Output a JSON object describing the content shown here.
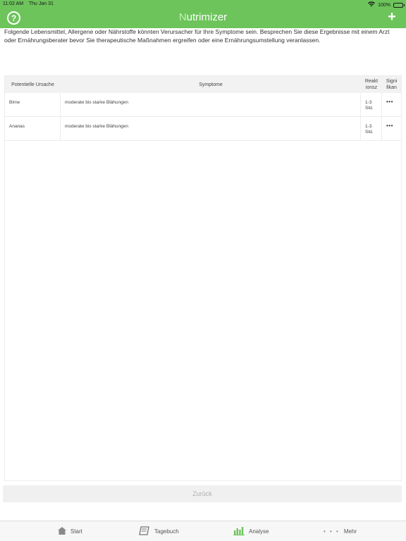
{
  "status": {
    "time": "11:02 AM",
    "date": "Thu Jan 31",
    "battery": "100%"
  },
  "header": {
    "title_first": "N",
    "title_rest": "utrimizer",
    "help_icon": "?",
    "add_icon": "+"
  },
  "intro": "Folgende Lebensmittel, Allergene oder Nährstoffe könnten Verursacher für Ihre Symptome sein. Besprechen Sie diese Ergebnisse mit einem Arzt oder Ernährungsberater bevor Sie therapeutische Maßnahmen ergreifen oder eine Ernährungsumstellung veranlassen.",
  "table": {
    "headers": {
      "cause": "Potentielle Ursache",
      "symptoms": "Symptome",
      "reaction_l1": "Reakt",
      "reaction_l2": "ionsz",
      "signif_l1": "Signi",
      "signif_l2": "fikan"
    },
    "rows": [
      {
        "cause": "Birne",
        "symptom": "moderate bis starke Blähungen",
        "reaction_l1": "1-3",
        "reaction_l2": "Std.",
        "signif": "•••"
      },
      {
        "cause": "Ananas",
        "symptom": "moderate bis starke Blähungen",
        "reaction_l1": "1-3",
        "reaction_l2": "Std.",
        "signif": "•••"
      }
    ]
  },
  "back_label": "Zurück",
  "tabs": {
    "start": "Start",
    "tagebuch": "Tagebuch",
    "analyse": "Analyse",
    "mehr": "Mehr",
    "mehr_dots": "• • •"
  },
  "colors": {
    "accent": "#6cc45b",
    "accent_light": "#c9f0b0"
  }
}
